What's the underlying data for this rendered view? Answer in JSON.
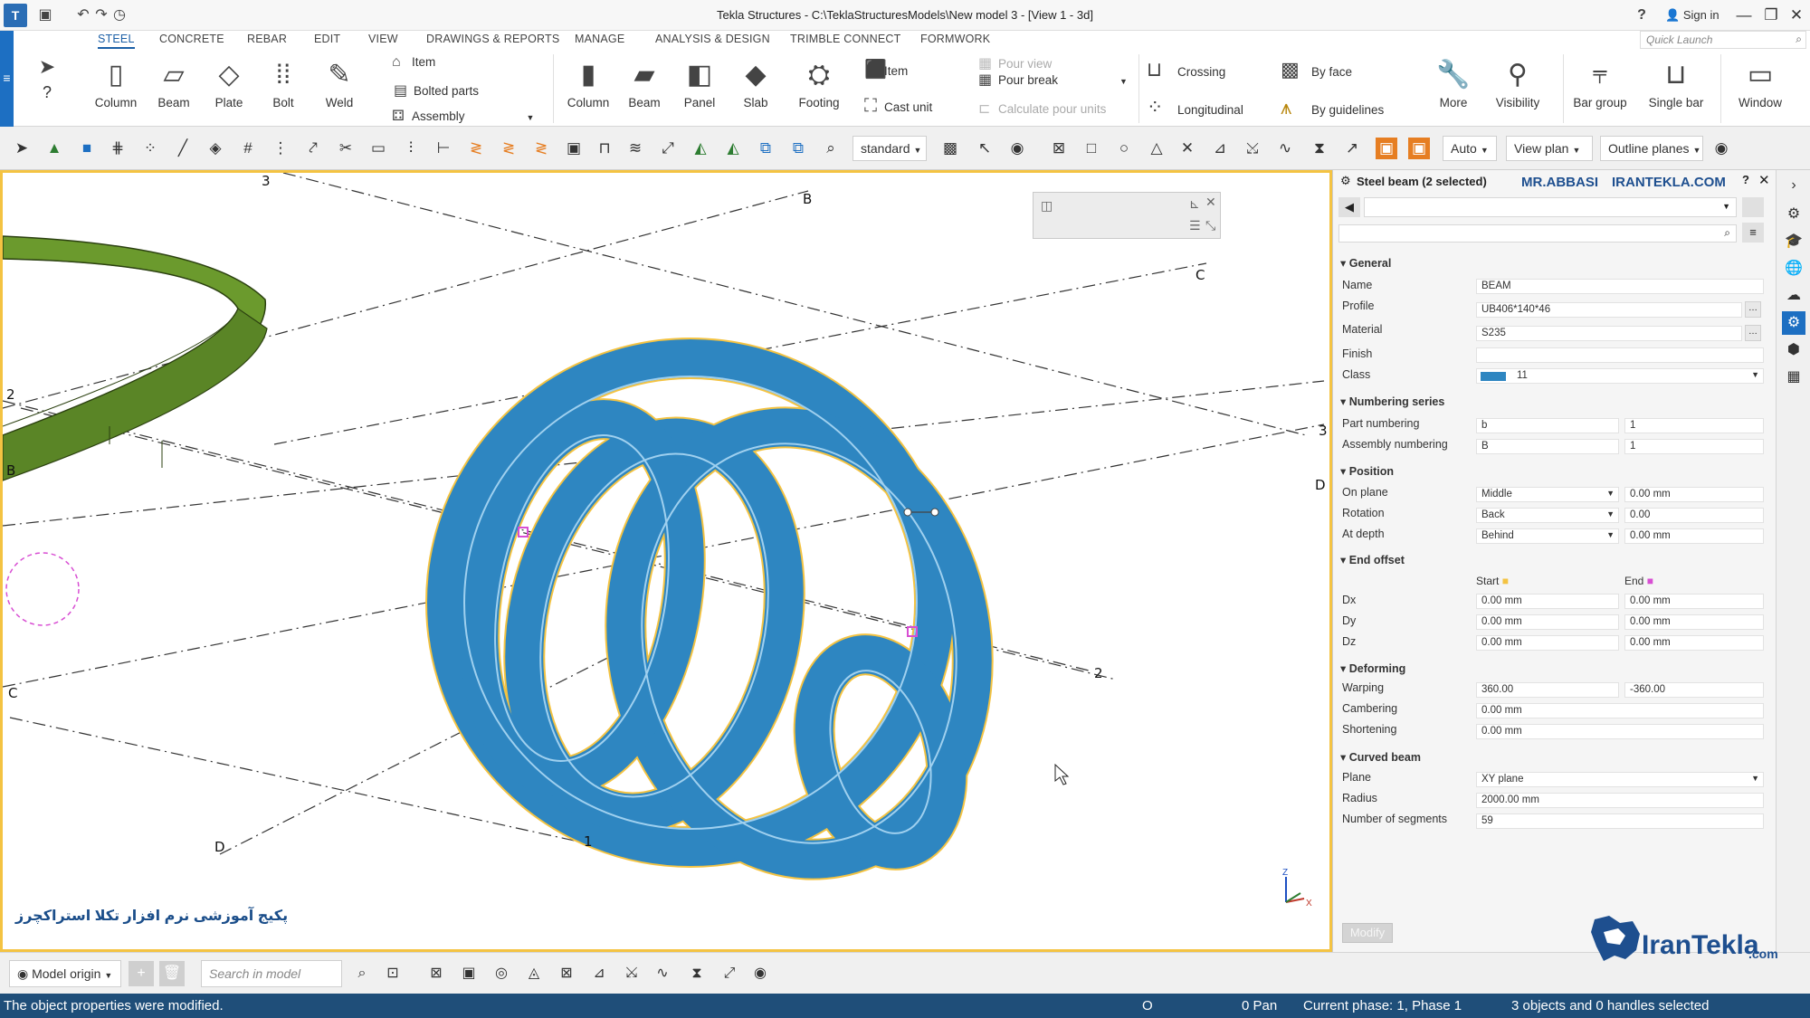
{
  "window": {
    "title": "Tekla Structures - C:\\TeklaStructuresModels\\New model 3 - [View 1 - 3d]",
    "sign_in": "Sign in",
    "help": "?",
    "minimize": "—",
    "restore": "❐",
    "close": "✕"
  },
  "menu_tabs": [
    "STEEL",
    "CONCRETE",
    "REBAR",
    "EDIT",
    "VIEW",
    "DRAWINGS & REPORTS",
    "MANAGE",
    "ANALYSIS & DESIGN",
    "TRIMBLE CONNECT",
    "FORMWORK"
  ],
  "active_tab": "STEEL",
  "quick_launch": {
    "placeholder": "Quick Launch"
  },
  "ribbon": {
    "column": "Column",
    "beam": "Beam",
    "plate": "Plate",
    "bolt": "Bolt",
    "weld": "Weld",
    "item": "Item",
    "bolted_parts": "Bolted parts",
    "assembly": "Assembly",
    "c_column": "Column",
    "c_beam": "Beam",
    "panel": "Panel",
    "slab": "Slab",
    "footing": "Footing",
    "c_item": "Item",
    "cast_unit": "Cast unit",
    "pour_view": "Pour view",
    "pour_break": "Pour break",
    "calc_pour": "Calculate pour units",
    "crossing": "Crossing",
    "longitudinal": "Longitudinal",
    "by_face": "By face",
    "by_guidelines": "By guidelines",
    "more": "More",
    "visibility": "Visibility",
    "bar_group": "Bar group",
    "single_bar": "Single bar",
    "window": "Window"
  },
  "toolbar": {
    "standard": "standard",
    "auto": "Auto",
    "view_plane": "View plan",
    "outline_planes": "Outline planes"
  },
  "viewport": {
    "grid_labels": [
      "3",
      "B",
      "C",
      "2",
      "3",
      "B",
      "D",
      "2",
      "C",
      "D",
      "1"
    ],
    "persian_text": "پکیج آموزشی نرم افزار تکلا استراکچرز",
    "axis_z": "Z",
    "axis_x": "X"
  },
  "props": {
    "title": "Steel beam (2 selected)",
    "watermark1": "MR.ABBASI",
    "watermark2": "IRANTEKLA.COM",
    "sections": {
      "general": "General",
      "numbering": "Numbering series",
      "position": "Position",
      "end_offset": "End offset",
      "deforming": "Deforming",
      "curved": "Curved beam"
    },
    "labels": {
      "name": "Name",
      "profile": "Profile",
      "material": "Material",
      "finish": "Finish",
      "class": "Class",
      "part_numbering": "Part numbering",
      "assembly_numbering": "Assembly numbering",
      "on_plane": "On plane",
      "rotation": "Rotation",
      "at_depth": "At depth",
      "start": "Start",
      "end": "End",
      "dx": "Dx",
      "dy": "Dy",
      "dz": "Dz",
      "warping": "Warping",
      "cambering": "Cambering",
      "shortening": "Shortening",
      "plane": "Plane",
      "radius": "Radius",
      "segments": "Number of segments"
    },
    "values": {
      "name": "BEAM",
      "profile": "UB406*140*46",
      "material": "S235",
      "finish": "",
      "class": "11",
      "part_prefix": "b",
      "part_start": "1",
      "asm_prefix": "B",
      "asm_start": "1",
      "on_plane": "Middle",
      "on_plane_val": "0.00 mm",
      "rotation": "Back",
      "rotation_val": "0.00",
      "at_depth": "Behind",
      "at_depth_val": "0.00 mm",
      "dx_start": "0.00 mm",
      "dx_end": "0.00 mm",
      "dy_start": "0.00 mm",
      "dy_end": "0.00 mm",
      "dz_start": "0.00 mm",
      "dz_end": "0.00 mm",
      "warping_start": "360.00",
      "warping_end": "-360.00",
      "cambering": "0.00 mm",
      "shortening": "0.00 mm",
      "plane": "XY plane",
      "radius": "2000.00 mm",
      "segments": "59"
    },
    "modify": "Modify"
  },
  "bottom": {
    "model_origin": "Model origin",
    "search_placeholder": "Search in model"
  },
  "status": {
    "message": "The object properties were modified.",
    "o": "O",
    "pan": "0  Pan",
    "phase": "Current phase: 1, Phase 1",
    "selection": "3 objects and 0 handles selected"
  },
  "logo": {
    "name": "IranTekla",
    "domain": ".com"
  },
  "colors": {
    "accent": "#1d6fc2",
    "beam_blue": "#2e86c1",
    "selection_yellow": "#f4c342",
    "slab_green": "#6b9a2d",
    "status_bar": "#1f4e79"
  }
}
